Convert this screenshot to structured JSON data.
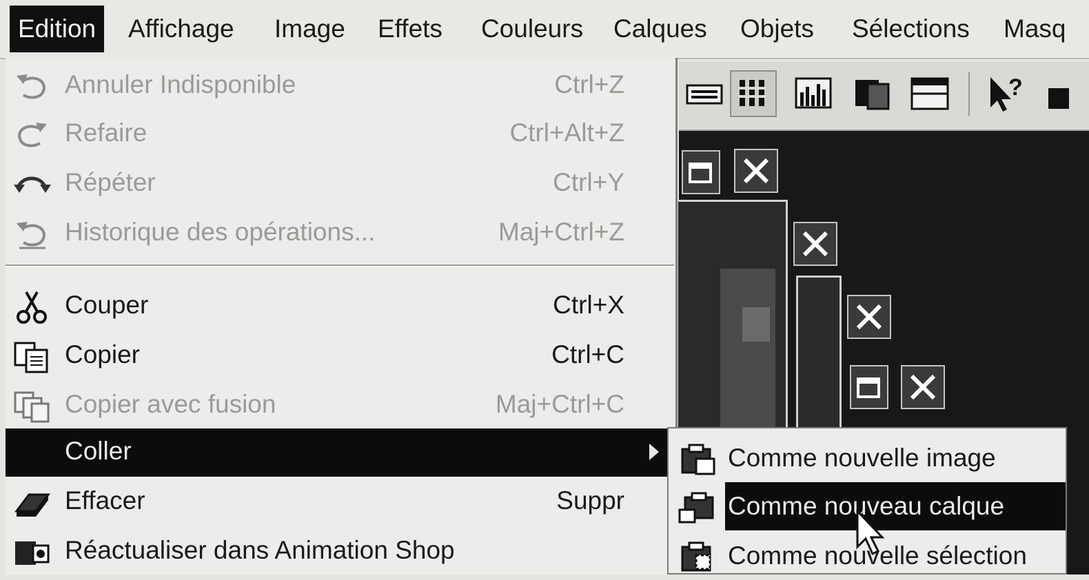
{
  "menubar": {
    "items": [
      "Edition",
      "Affichage",
      "Image",
      "Effets",
      "Couleurs",
      "Calques",
      "Objets",
      "Sélections",
      "Masq"
    ]
  },
  "edit_menu": {
    "items": [
      {
        "label": "Annuler Indisponible",
        "shortcut": "Ctrl+Z",
        "icon": "undo-icon",
        "enabled": false
      },
      {
        "label": "Refaire",
        "shortcut": "Ctrl+Alt+Z",
        "icon": "redo-icon",
        "enabled": false
      },
      {
        "label": "Répéter",
        "shortcut": "Ctrl+Y",
        "icon": "repeat-icon",
        "enabled": false
      },
      {
        "label": "Historique des opérations...",
        "shortcut": "Maj+Ctrl+Z",
        "icon": "history-icon",
        "enabled": false
      },
      {
        "label": "Couper",
        "shortcut": "Ctrl+X",
        "icon": "scissors-icon",
        "enabled": true
      },
      {
        "label": "Copier",
        "shortcut": "Ctrl+C",
        "icon": "copy-icon",
        "enabled": true
      },
      {
        "label": "Copier avec fusion",
        "shortcut": "Maj+Ctrl+C",
        "icon": "copy-merged-icon",
        "enabled": false
      },
      {
        "label": "Coller",
        "shortcut": "",
        "icon": "",
        "enabled": true,
        "highlighted": true,
        "has_submenu": true
      },
      {
        "label": "Effacer",
        "shortcut": "Suppr",
        "icon": "eraser-icon",
        "enabled": true
      },
      {
        "label": "Réactualiser dans Animation Shop",
        "shortcut": "",
        "icon": "animation-shop-icon",
        "enabled": true
      }
    ]
  },
  "paste_submenu": {
    "items": [
      {
        "label": "Comme nouvelle image",
        "icon": "paste-new-image-icon"
      },
      {
        "label": "Comme nouveau calque",
        "icon": "paste-new-layer-icon",
        "highlighted": true
      },
      {
        "label": "Comme nouvelle sélection",
        "icon": "paste-new-selection-icon"
      }
    ]
  },
  "colors": {
    "menu_bg": "#ececea",
    "highlight": "#0c0c0c",
    "disabled_text": "#9a9a98",
    "workspace_bg": "#181818"
  }
}
